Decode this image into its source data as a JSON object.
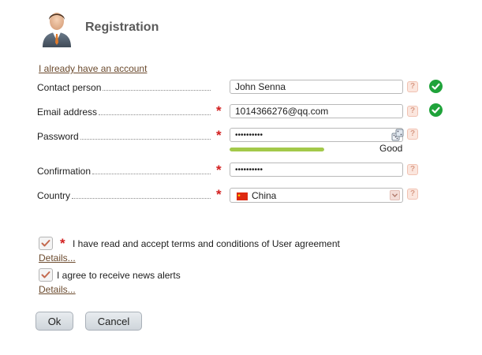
{
  "header": {
    "title": "Registration",
    "avatar_icon": "user-avatar-icon",
    "account_link": "I already have an account"
  },
  "form": {
    "contact": {
      "label": "Contact person",
      "value": "John Senna",
      "help": "?",
      "required": "",
      "status": "valid"
    },
    "email": {
      "label": "Email address",
      "value": "1014366276@qq.com",
      "help": "?",
      "required": "*",
      "status": "valid"
    },
    "password": {
      "label": "Password",
      "value": "••••••••••",
      "help": "?",
      "required": "*",
      "strength_text": "Good",
      "strength_level": 1.0,
      "generator_icon": "dice-icon"
    },
    "confirmation": {
      "label": "Confirmation",
      "value": "••••••••••",
      "help": "?",
      "required": "*"
    },
    "country": {
      "label": "Country",
      "value": "China",
      "help": "?",
      "required": "*",
      "flag_icon": "china-flag-icon"
    }
  },
  "agreements": {
    "terms": {
      "checked": true,
      "required": "*",
      "label": "I have read and accept terms and conditions of User agreement",
      "details": "Details..."
    },
    "news": {
      "checked": true,
      "label": "I agree to receive news alerts",
      "details": "Details..."
    }
  },
  "buttons": {
    "ok": "Ok",
    "cancel": "Cancel"
  },
  "colors": {
    "required": "#d21f1f",
    "valid": "#1fa33a",
    "strength": "#a3c94a",
    "link": "#6b4a2d"
  }
}
